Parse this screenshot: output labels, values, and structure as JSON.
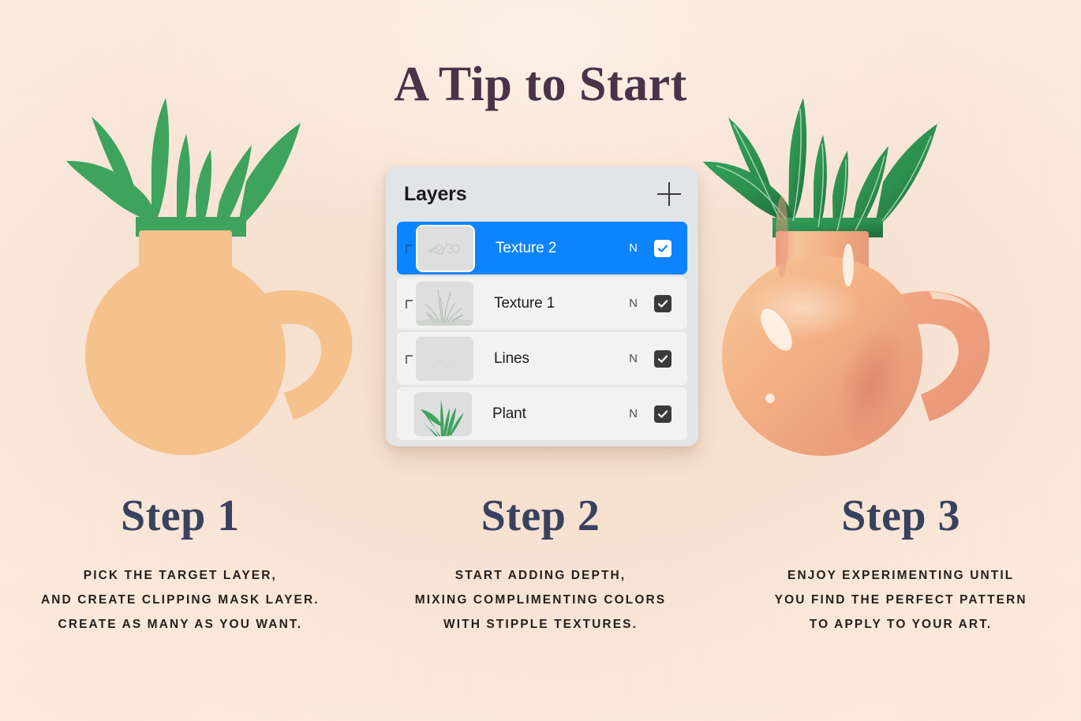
{
  "page": {
    "title": "A Tip to Start",
    "background_color": "#f7e2d1",
    "title_color": "#4a3349",
    "step_heading_color": "#39415f",
    "body_text_color": "#241f1c"
  },
  "layers_panel": {
    "header_title": "Layers",
    "add_button_icon": "plus-icon",
    "accent_color": "#0b84fe",
    "panel_background": "#e3e4e6",
    "row_background": "#f2f2f3",
    "rows": [
      {
        "name": "Texture 2",
        "blend_mode": "N",
        "visible": true,
        "selected": true,
        "clipping_mask": true,
        "thumbnail": "faint-scribble-texture"
      },
      {
        "name": "Texture 1",
        "blend_mode": "N",
        "visible": true,
        "selected": false,
        "clipping_mask": true,
        "thumbnail": "faint-grass-strokes"
      },
      {
        "name": "Lines",
        "blend_mode": "N",
        "visible": true,
        "selected": false,
        "clipping_mask": true,
        "thumbnail": "empty-gray"
      },
      {
        "name": "Plant",
        "blend_mode": "N",
        "visible": true,
        "selected": false,
        "clipping_mask": false,
        "thumbnail": "green-plant"
      }
    ]
  },
  "illustrations": {
    "left": {
      "name": "flat-vase-with-plant",
      "vase_color": "#f5c18c",
      "leaf_color": "#3da35d"
    },
    "right": {
      "name": "shaded-vase-with-plant",
      "vase_color": "#f3b184",
      "leaf_color": "#2e9150"
    }
  },
  "steps": [
    {
      "heading": "Step 1",
      "lines": [
        "PICK THE TARGET LAYER,",
        "AND CREATE CLIPPING MASK LAYER.",
        "CREATE AS MANY AS YOU WANT."
      ]
    },
    {
      "heading": "Step 2",
      "lines": [
        "START ADDING DEPTH,",
        "MIXING COMPLIMENTING COLORS",
        "WITH STIPPLE TEXTURES."
      ]
    },
    {
      "heading": "Step 3",
      "lines": [
        "ENJOY EXPERIMENTING UNTIL",
        "YOU FIND THE PERFECT PATTERN",
        "TO APPLY TO YOUR ART."
      ]
    }
  ]
}
